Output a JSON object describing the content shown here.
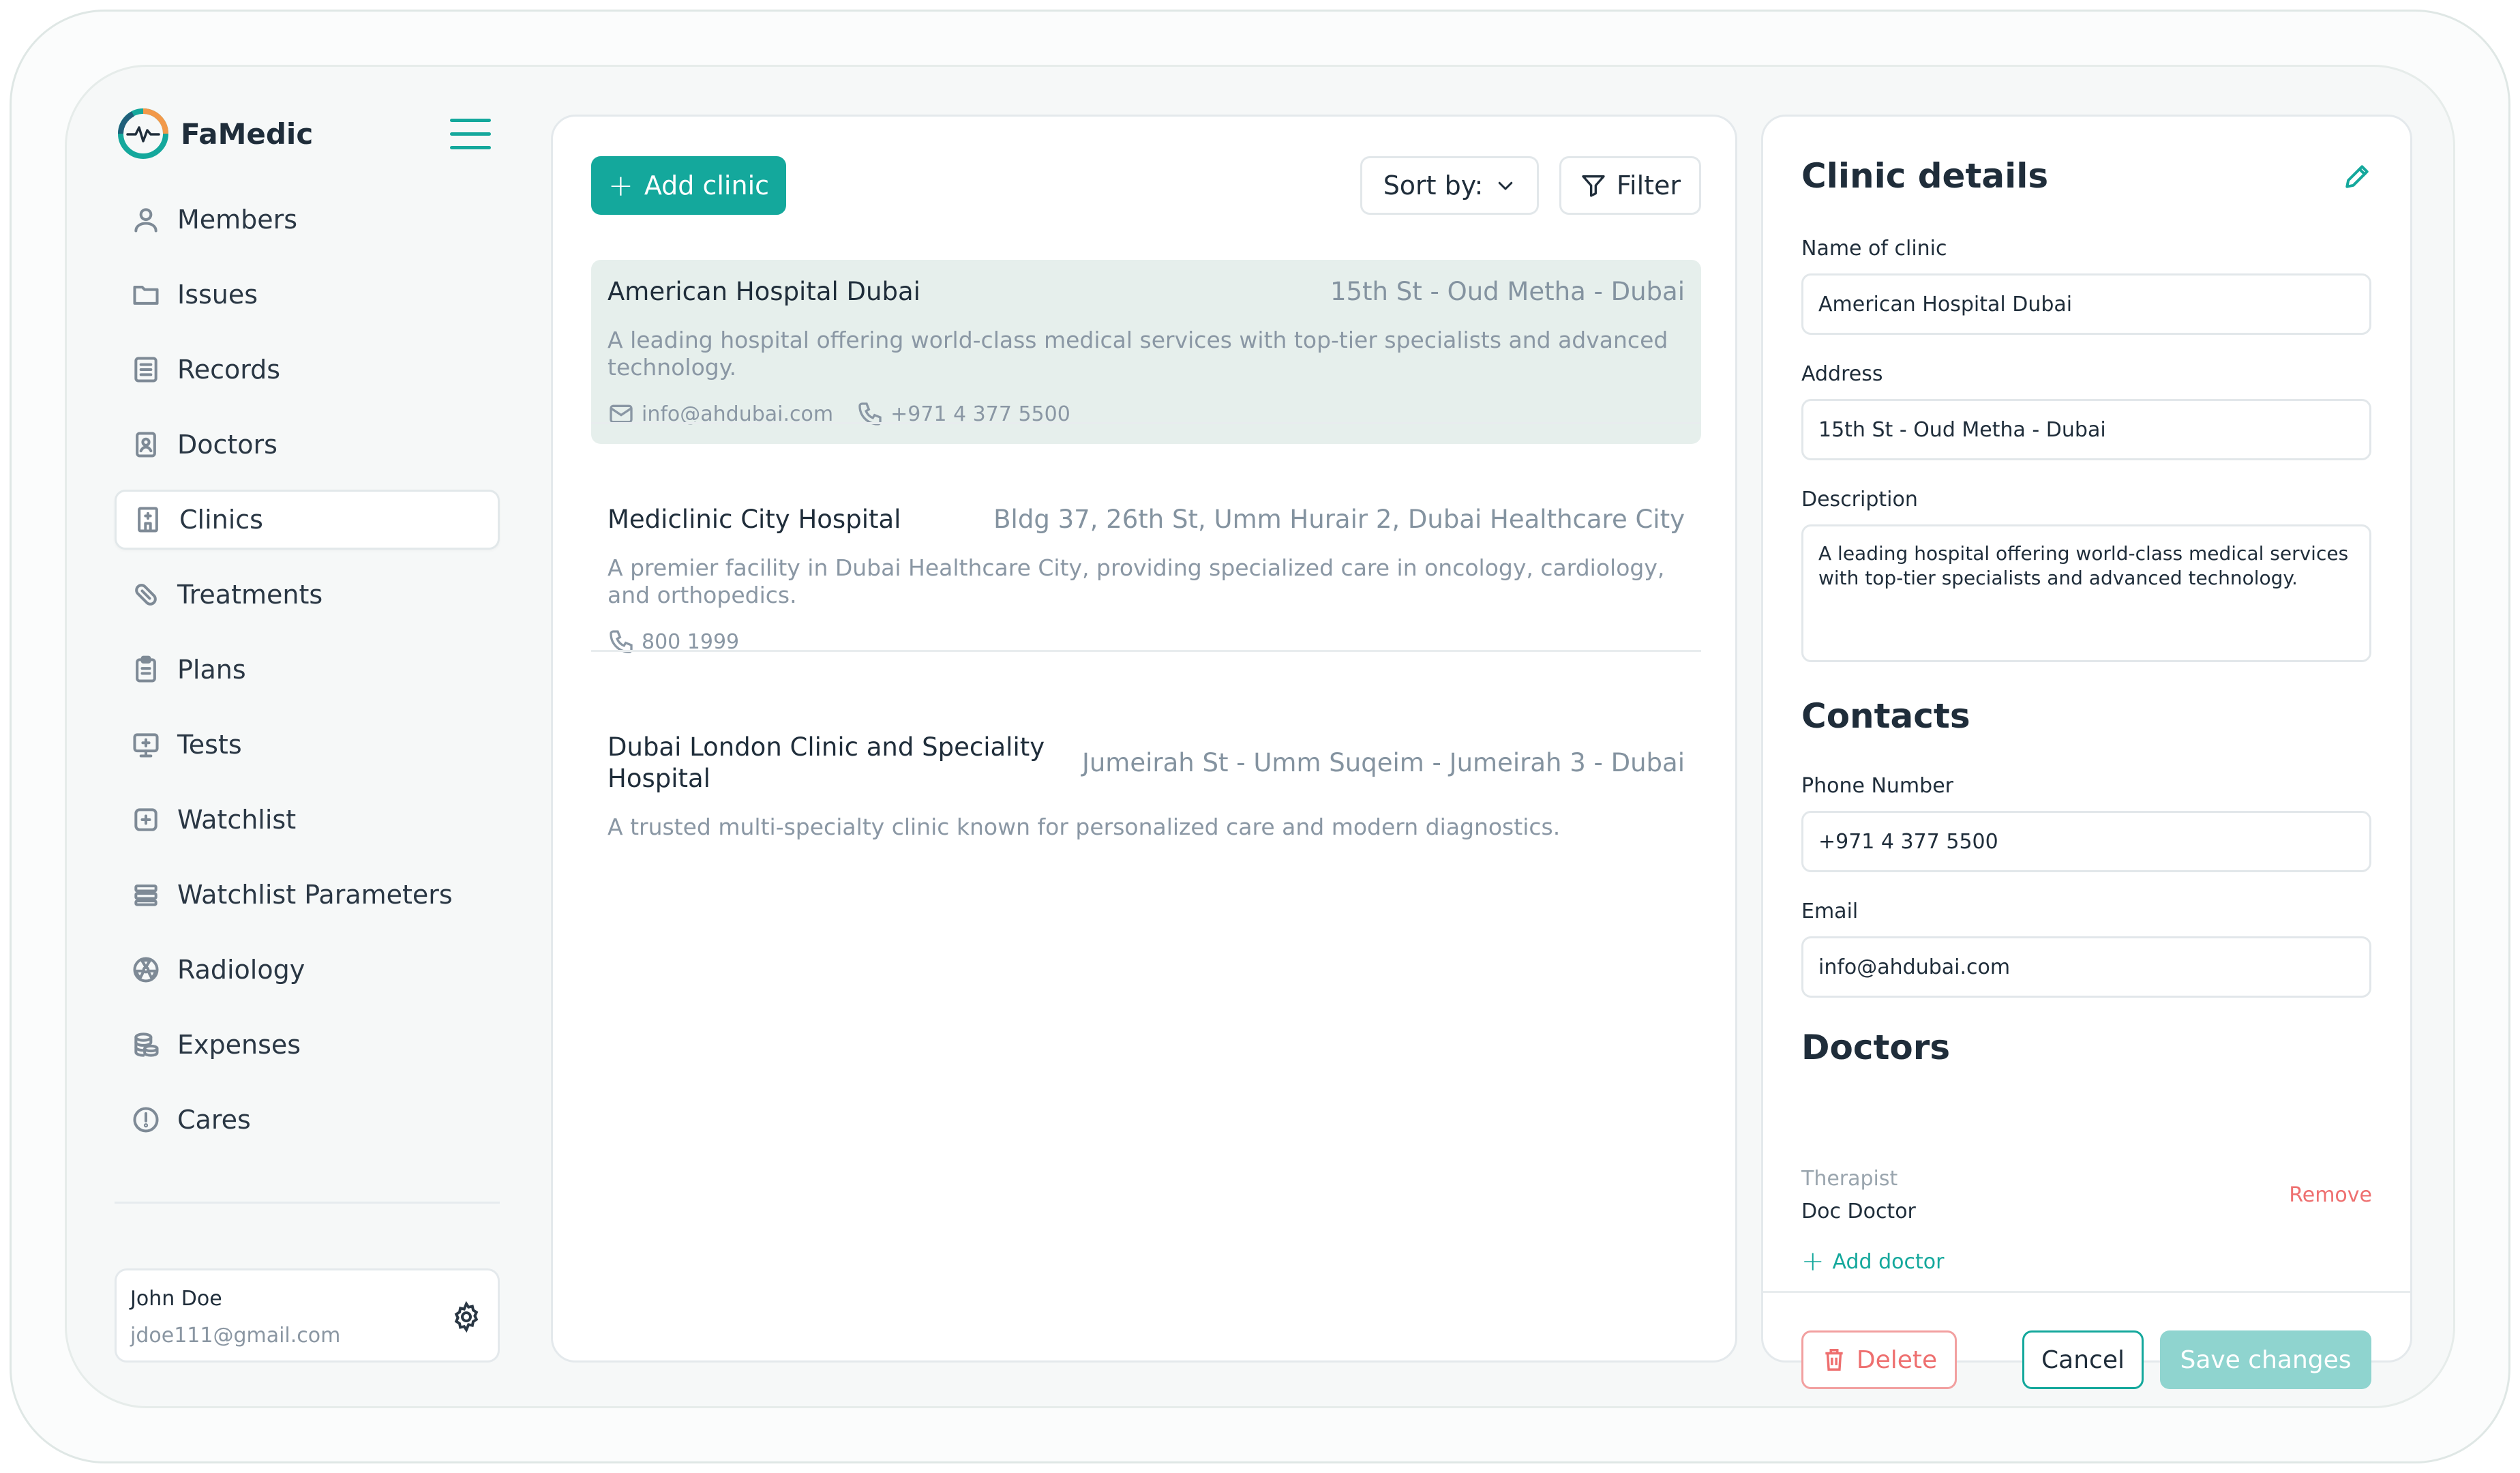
{
  "brand": {
    "name": "FaMedic"
  },
  "nav": {
    "items": [
      {
        "label": "Members",
        "icon": "user-icon"
      },
      {
        "label": "Issues",
        "icon": "folder-icon"
      },
      {
        "label": "Records",
        "icon": "document-list-icon"
      },
      {
        "label": "Doctors",
        "icon": "doctor-badge-icon"
      },
      {
        "label": "Clinics",
        "icon": "building-icon",
        "active": true
      },
      {
        "label": "Treatments",
        "icon": "pill-icon"
      },
      {
        "label": "Plans",
        "icon": "clipboard-icon"
      },
      {
        "label": "Tests",
        "icon": "monitor-plus-icon"
      },
      {
        "label": "Watchlist",
        "icon": "bookmark-plus-icon"
      },
      {
        "label": "Watchlist Parameters",
        "icon": "stack-icon"
      },
      {
        "label": "Radiology",
        "icon": "radiation-icon"
      },
      {
        "label": "Expenses",
        "icon": "coins-icon"
      },
      {
        "label": "Cares",
        "icon": "alert-circle-icon"
      }
    ]
  },
  "user": {
    "name": "John Doe",
    "email": "jdoe111@gmail.com"
  },
  "toolbar": {
    "add_label": "Add clinic",
    "sort_label": "Sort by:",
    "filter_label": "Filter"
  },
  "clinics": [
    {
      "name": "American Hospital Dubai",
      "address": "15th St - Oud Metha - Dubai",
      "description": "A leading hospital offering world-class medical services with top-tier specialists and advanced technology.",
      "email": "info@ahdubai.com",
      "phone": "+971 4 377 5500"
    },
    {
      "name": "Mediclinic City Hospital",
      "address": "Bldg 37, 26th St, Umm Hurair 2, Dubai Healthcare City",
      "description": "A premier facility in Dubai Healthcare City, providing specialized care in oncology, cardiology, and orthopedics.",
      "phone": "800 1999"
    },
    {
      "name": "Dubai London Clinic and Speciality Hospital",
      "address": "Jumeirah St - Umm Suqeim - Jumeirah 3 - Dubai",
      "description": "A trusted multi-specialty clinic known for personalized care and modern diagnostics."
    }
  ],
  "details": {
    "title": "Clinic details",
    "name_label": "Name of clinic",
    "name_value": "American Hospital Dubai",
    "address_label": "Address",
    "address_value": "15th St - Oud Metha - Dubai",
    "description_label": "Description",
    "description_value": "A leading hospital offering world-class medical services with top-tier specialists and advanced technology.",
    "contacts_title": "Contacts",
    "phone_label": "Phone Number",
    "phone_value": "+971 4 377 5500",
    "email_label": "Email",
    "email_value": "info@ahdubai.com",
    "doctors_title": "Doctors",
    "doctor": {
      "specialty": "Therapist",
      "name": "Doc Doctor",
      "remove_label": "Remove"
    },
    "add_doctor_label": "Add doctor",
    "delete_label": "Delete",
    "cancel_label": "Cancel",
    "save_label": "Save changes"
  },
  "colors": {
    "accent": "#14a89c",
    "accent_disabled": "#8fd4cf",
    "danger": "#ee6f6f",
    "selected_bg": "#e6efec"
  }
}
